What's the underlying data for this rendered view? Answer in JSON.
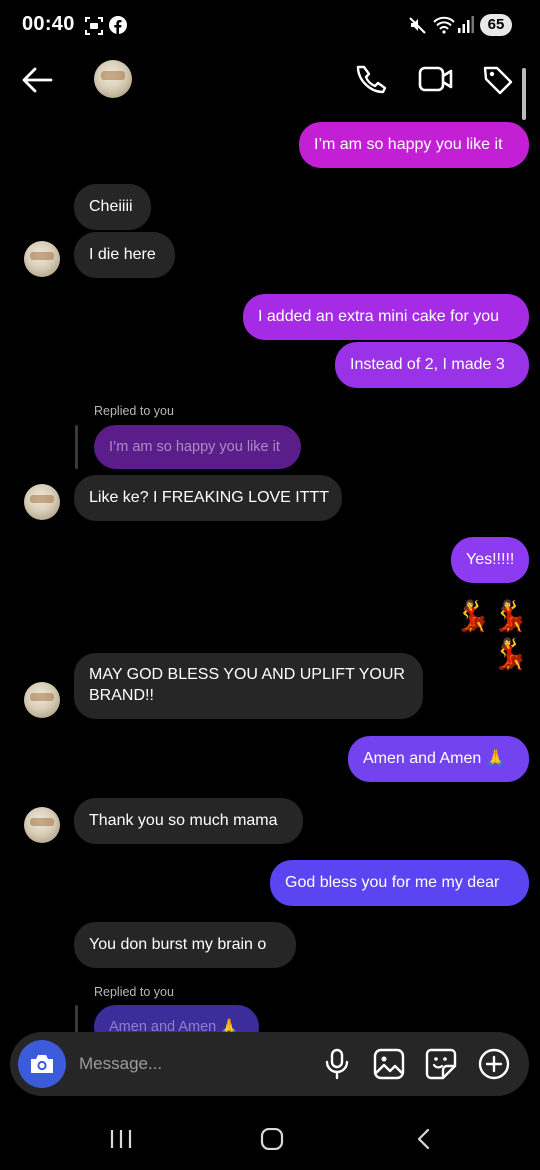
{
  "status_bar": {
    "time": "00:40",
    "battery": "65"
  },
  "header": {
    "avatar_icon": "profile-avatar",
    "icons": [
      "back-arrow-icon",
      "phone-icon",
      "video-call-icon",
      "tag-icon"
    ]
  },
  "thread": {
    "m1": "I’m am so happy you like it",
    "m2": "Cheiiii",
    "m3": "I die here",
    "m4": "I added an extra mini cake for you",
    "m5": "Instead of 2, I made 3",
    "reply1_label": "Replied to you",
    "reply1_quote": "I’m am so happy you like it",
    "m6": "Like ke? I FREAKING LOVE ITTT",
    "m7": "Yes!!!!!",
    "m8": "💃💃💃",
    "m9": "MAY GOD BLESS YOU AND UPLIFT YOUR BRAND!!",
    "m10": "Amen and Amen 🙏",
    "m11": "Thank you so much mama",
    "m12": "God bless you for me my dear",
    "m13": "You don burst my brain o",
    "reply2_label": "Replied to you",
    "reply2_quote": "Amen and Amen 🙏"
  },
  "composer": {
    "placeholder": "Message...",
    "icons": [
      "camera-icon",
      "microphone-icon",
      "gallery-icon",
      "sticker-icon",
      "add-icon"
    ]
  },
  "colors": {
    "magenta": "#c320d6",
    "violet": "#8d3bf0",
    "indigo": "#5b44f2",
    "incoming": "#262626",
    "camera": "#3b5bdb"
  }
}
